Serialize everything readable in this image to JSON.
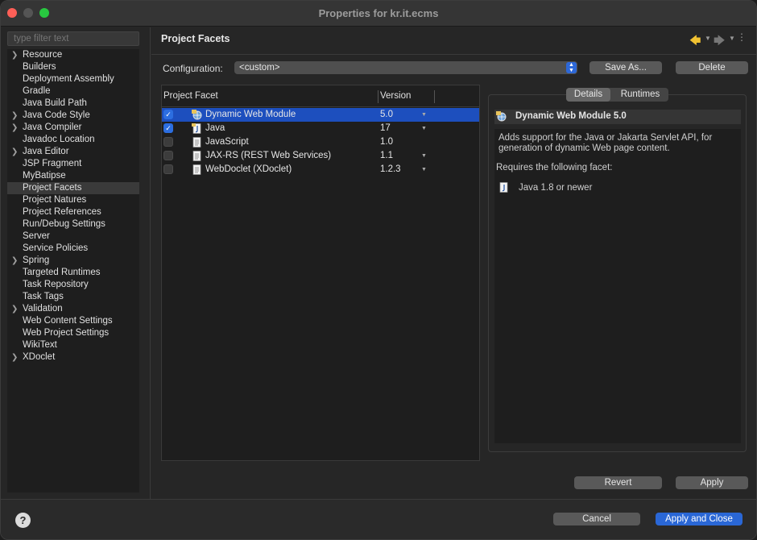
{
  "window": {
    "title": "Properties for kr.it.ecms"
  },
  "sidebar": {
    "filter_placeholder": "type filter text",
    "items": [
      {
        "label": "Resource",
        "expandable": true
      },
      {
        "label": "Builders"
      },
      {
        "label": "Deployment Assembly"
      },
      {
        "label": "Gradle"
      },
      {
        "label": "Java Build Path"
      },
      {
        "label": "Java Code Style",
        "expandable": true
      },
      {
        "label": "Java Compiler",
        "expandable": true
      },
      {
        "label": "Javadoc Location"
      },
      {
        "label": "Java Editor",
        "expandable": true
      },
      {
        "label": "JSP Fragment"
      },
      {
        "label": "MyBatipse"
      },
      {
        "label": "Project Facets",
        "selected": true
      },
      {
        "label": "Project Natures"
      },
      {
        "label": "Project References"
      },
      {
        "label": "Run/Debug Settings"
      },
      {
        "label": "Server"
      },
      {
        "label": "Service Policies"
      },
      {
        "label": "Spring",
        "expandable": true
      },
      {
        "label": "Targeted Runtimes"
      },
      {
        "label": "Task Repository"
      },
      {
        "label": "Task Tags"
      },
      {
        "label": "Validation",
        "expandable": true
      },
      {
        "label": "Web Content Settings"
      },
      {
        "label": "Web Project Settings"
      },
      {
        "label": "WikiText"
      },
      {
        "label": "XDoclet",
        "expandable": true
      }
    ]
  },
  "main": {
    "page_title": "Project Facets",
    "configuration": {
      "label": "Configuration:",
      "value": "<custom>"
    },
    "buttons": {
      "save_as": "Save As...",
      "delete": "Delete",
      "revert": "Revert",
      "apply": "Apply"
    },
    "facets_table": {
      "headers": {
        "facet": "Project Facet",
        "version": "Version"
      },
      "rows": [
        {
          "name": "Dynamic Web Module",
          "version": "5.0",
          "checked": true,
          "selected": true,
          "has_dropdown": true,
          "icon": "web-module-icon"
        },
        {
          "name": "Java",
          "version": "17",
          "checked": true,
          "has_dropdown": true,
          "icon": "java-icon"
        },
        {
          "name": "JavaScript",
          "version": "1.0",
          "checked": false,
          "has_dropdown": false,
          "icon": "document-icon"
        },
        {
          "name": "JAX-RS (REST Web Services)",
          "version": "1.1",
          "checked": false,
          "has_dropdown": true,
          "icon": "document-icon"
        },
        {
          "name": "WebDoclet (XDoclet)",
          "version": "1.2.3",
          "checked": false,
          "has_dropdown": true,
          "icon": "document-icon"
        }
      ]
    },
    "details": {
      "tabs": [
        "Details",
        "Runtimes"
      ],
      "active_tab": "Details",
      "title": "Dynamic Web Module 5.0",
      "description": "Adds support for the Java or Jakarta Servlet API, for generation of dynamic Web page content.",
      "requires_label": "Requires the following facet:",
      "requires_item": "Java 1.8 or newer"
    }
  },
  "footer": {
    "help": "?",
    "cancel": "Cancel",
    "apply_and_close": "Apply and Close"
  },
  "colors": {
    "accent": "#2a67d6",
    "selection": "#1d4fbe"
  }
}
